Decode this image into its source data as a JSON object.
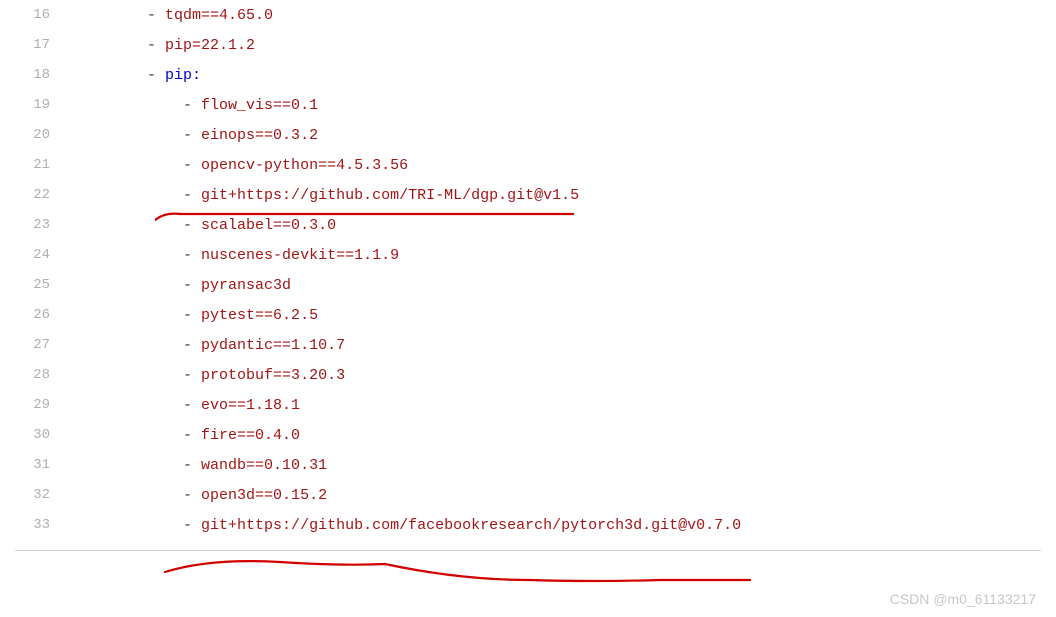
{
  "watermark": "CSDN @m0_61133217",
  "lines": [
    {
      "num": "16",
      "indent": "        ",
      "dash": "- ",
      "segments": [
        {
          "text": "tqdm==4.65.0",
          "cls": "value"
        }
      ]
    },
    {
      "num": "17",
      "indent": "        ",
      "dash": "- ",
      "segments": [
        {
          "text": "pip=22.1.2",
          "cls": "value"
        }
      ]
    },
    {
      "num": "18",
      "indent": "        ",
      "dash": "- ",
      "segments": [
        {
          "text": "pip:",
          "cls": "keyword"
        }
      ]
    },
    {
      "num": "19",
      "indent": "            ",
      "dash": "- ",
      "segments": [
        {
          "text": "flow_vis==0.1",
          "cls": "value"
        }
      ]
    },
    {
      "num": "20",
      "indent": "            ",
      "dash": "- ",
      "segments": [
        {
          "text": "einops==0.3.2",
          "cls": "value"
        }
      ]
    },
    {
      "num": "21",
      "indent": "            ",
      "dash": "- ",
      "segments": [
        {
          "text": "opencv-python==4.5.3.56",
          "cls": "value"
        }
      ]
    },
    {
      "num": "22",
      "indent": "            ",
      "dash": "- ",
      "segments": [
        {
          "text": "git+https://github.com/TRI-ML/dgp.git@v1.5",
          "cls": "value"
        }
      ]
    },
    {
      "num": "23",
      "indent": "            ",
      "dash": "- ",
      "segments": [
        {
          "text": "scalabel==0.3.0",
          "cls": "value"
        }
      ]
    },
    {
      "num": "24",
      "indent": "            ",
      "dash": "- ",
      "segments": [
        {
          "text": "nuscenes-devkit==1.1.9",
          "cls": "value"
        }
      ]
    },
    {
      "num": "25",
      "indent": "            ",
      "dash": "- ",
      "segments": [
        {
          "text": "pyransac3d",
          "cls": "value"
        }
      ]
    },
    {
      "num": "26",
      "indent": "            ",
      "dash": "- ",
      "segments": [
        {
          "text": "pytest==6.2.5",
          "cls": "value"
        }
      ]
    },
    {
      "num": "27",
      "indent": "            ",
      "dash": "- ",
      "segments": [
        {
          "text": "pydantic==1.10.7",
          "cls": "value"
        }
      ]
    },
    {
      "num": "28",
      "indent": "            ",
      "dash": "- ",
      "segments": [
        {
          "text": "protobuf==3.20.3",
          "cls": "value"
        }
      ]
    },
    {
      "num": "29",
      "indent": "            ",
      "dash": "- ",
      "segments": [
        {
          "text": "evo==1.18.1",
          "cls": "value"
        }
      ]
    },
    {
      "num": "30",
      "indent": "            ",
      "dash": "- ",
      "segments": [
        {
          "text": "fire==0.4.0",
          "cls": "value"
        }
      ]
    },
    {
      "num": "31",
      "indent": "            ",
      "dash": "- ",
      "segments": [
        {
          "text": "wandb==0.10.31",
          "cls": "value"
        }
      ]
    },
    {
      "num": "32",
      "indent": "            ",
      "dash": "- ",
      "segments": [
        {
          "text": "open3d==0.15.2",
          "cls": "value"
        }
      ]
    },
    {
      "num": "33",
      "indent": "            ",
      "dash": "- ",
      "segments": [
        {
          "text": "git+https://github.com/facebookresearch/pytorch3d.git@v0.7.0",
          "cls": "value"
        }
      ]
    }
  ]
}
